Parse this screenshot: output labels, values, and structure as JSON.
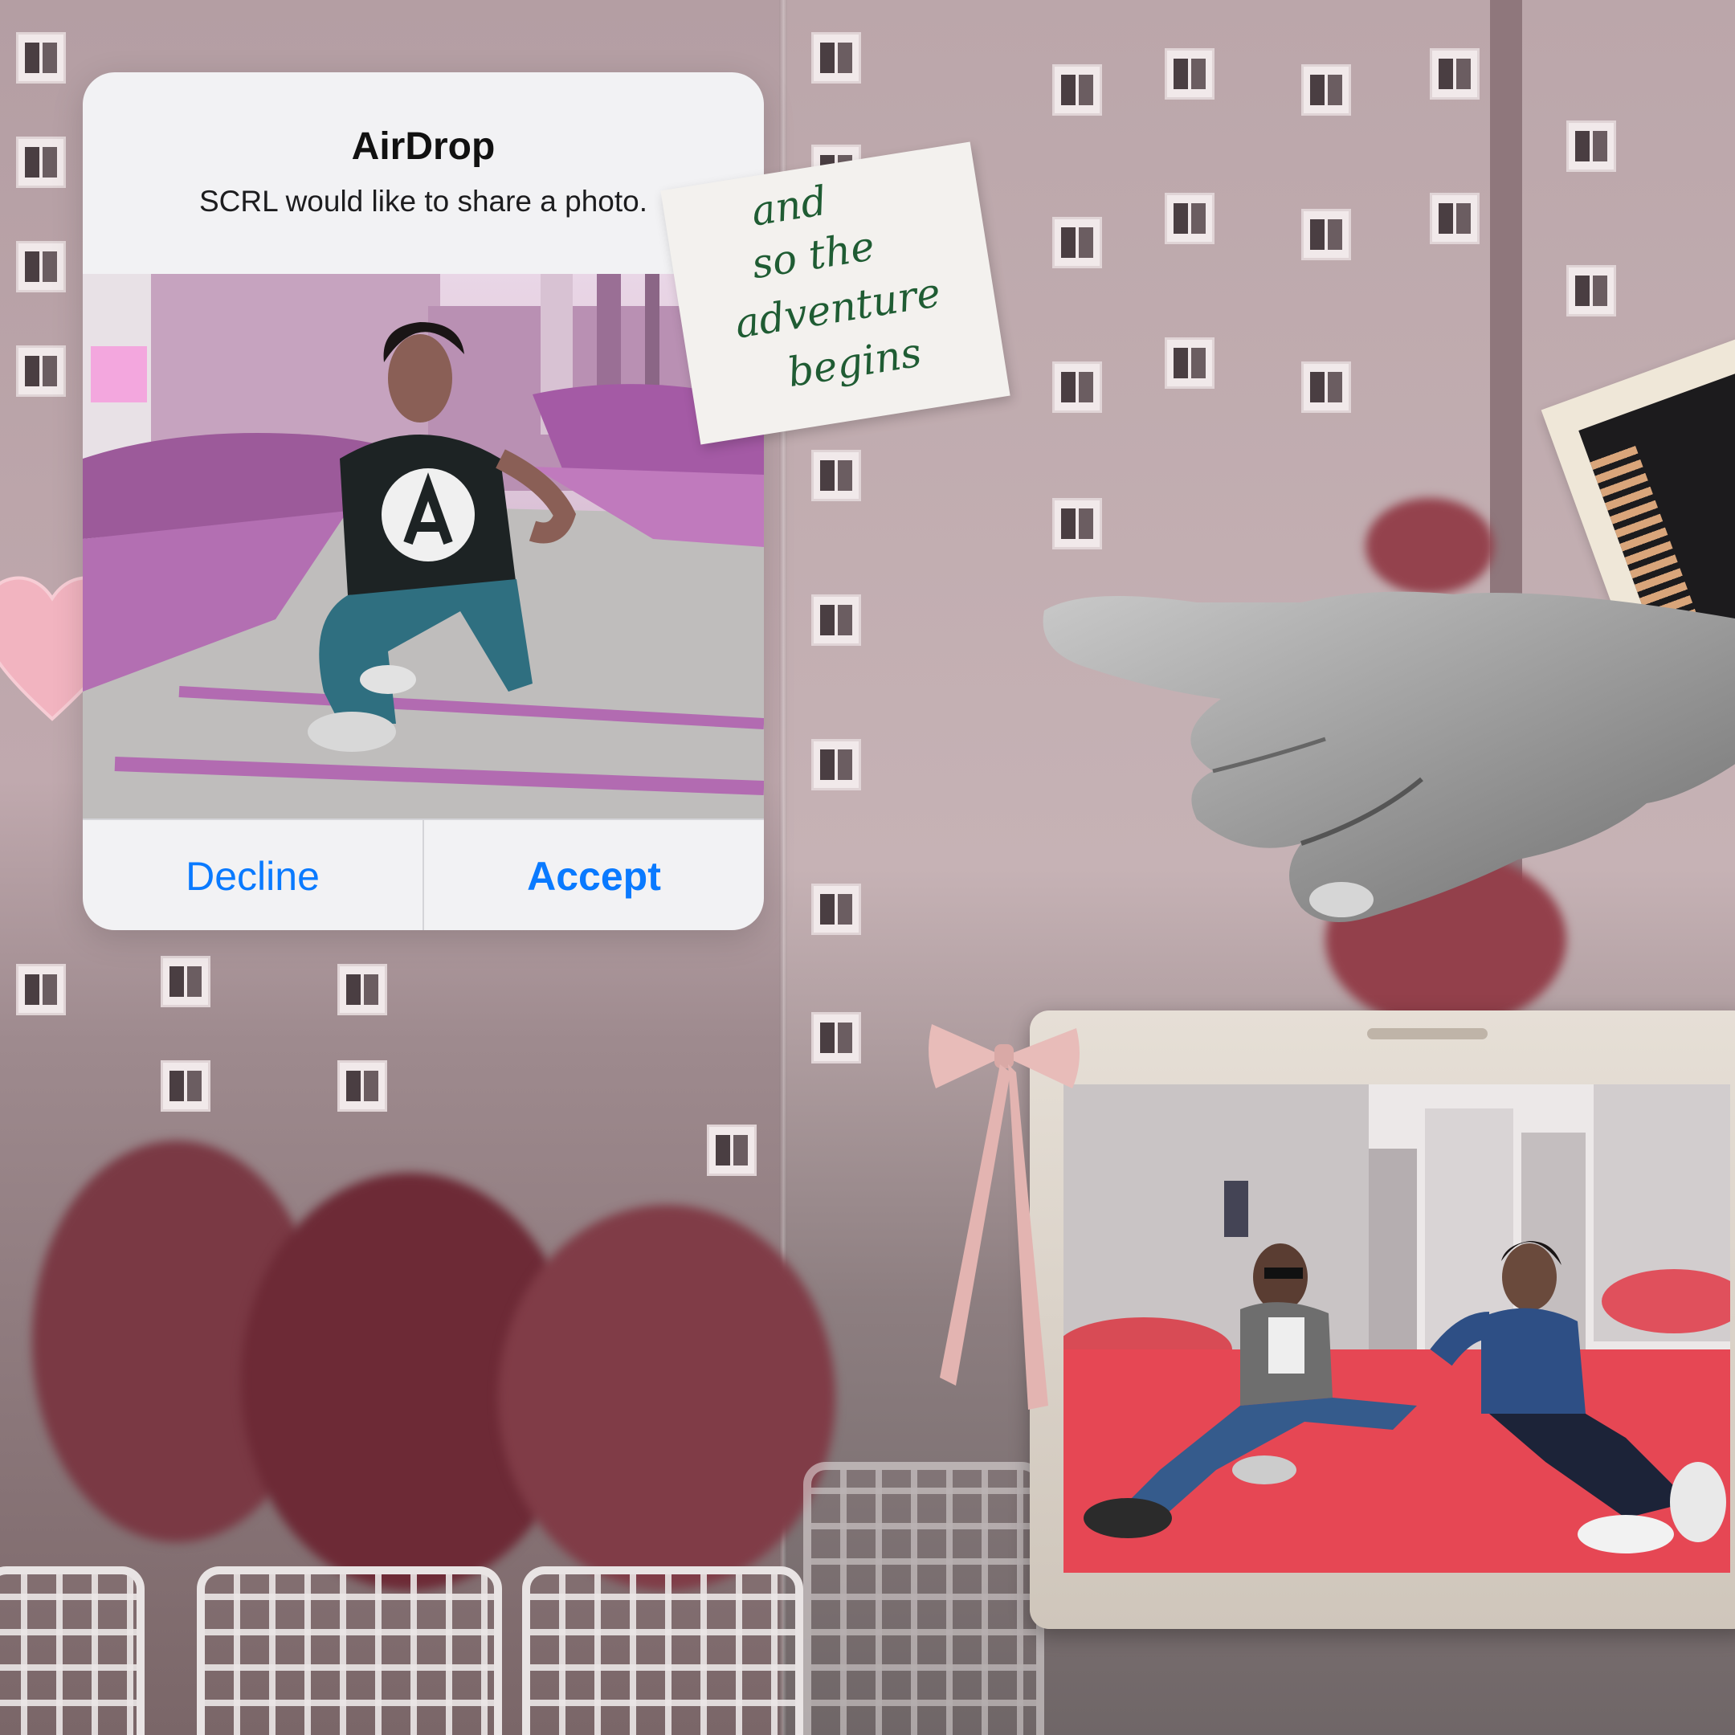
{
  "alert": {
    "title": "AirDrop",
    "message": "SCRL would like to share a photo.",
    "decline_label": "Decline",
    "accept_label": "Accept",
    "accent_color": "#0a7aff"
  },
  "note": {
    "lines": [
      "and",
      "so the",
      "adventure",
      "begins"
    ],
    "ink_color": "#1f5c33"
  },
  "icons": {
    "heart": "heart-icon",
    "ribbon": "ribbon-bow-icon",
    "hand": "pointing-hand-icon"
  }
}
